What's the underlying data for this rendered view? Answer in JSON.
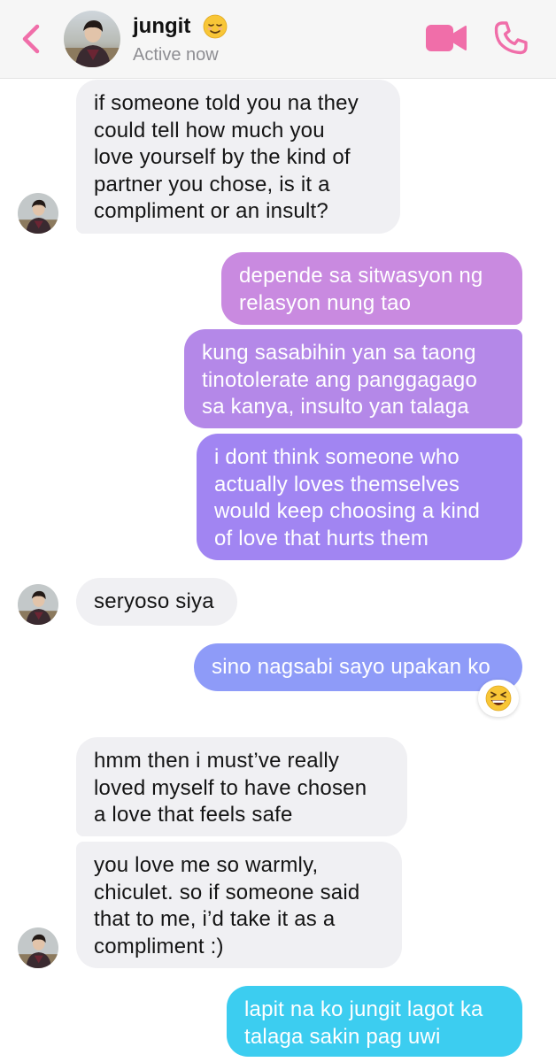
{
  "header": {
    "contact_name": "jungit",
    "name_emoji_icon": "relieved-face-icon",
    "status": "Active now",
    "back_icon": "chevron-left-icon",
    "video_icon": "video-camera-icon",
    "call_icon": "phone-icon",
    "accent_color": "#f06ea9"
  },
  "messages": [
    {
      "from": "contact",
      "text": "if someone told you na they\ncould tell how much you\nlove yourself by the kind of\npartner you chose, is it a\ncompliment or an insult?"
    },
    {
      "from": "me",
      "text": "depende sa sitwasyon ng\nrelasyon nung tao",
      "color": "#c98ae0"
    },
    {
      "from": "me",
      "text": "kung sasabihin yan sa taong\ntinotolerate ang panggagago\nsa kanya, insulto yan talaga",
      "color": "#b488e8"
    },
    {
      "from": "me",
      "text": "i dont think someone who\nactually loves themselves\nwould keep choosing a kind\nof love that hurts them",
      "color": "#a185f2"
    },
    {
      "from": "contact",
      "text": "seryoso siya"
    },
    {
      "from": "me",
      "text": "sino nagsabi sayo upakan ko",
      "color": "#8e9bf8",
      "reaction": "grinning-squinting-face-icon"
    },
    {
      "from": "contact",
      "text": "hmm then i must’ve really\nloved myself to have chosen\na love that feels safe"
    },
    {
      "from": "contact",
      "text": "you love me so warmly,\nchiculet. so if someone said\nthat to me, i’d take it as a\ncompliment :)"
    },
    {
      "from": "me",
      "text": "lapit na ko jungit lagot ka\ntalaga sakin pag uwi",
      "color": "#3ccdf0"
    }
  ],
  "colors": {
    "contact_bubble": "#f0f0f3",
    "header_bg": "#f6f6f6"
  }
}
